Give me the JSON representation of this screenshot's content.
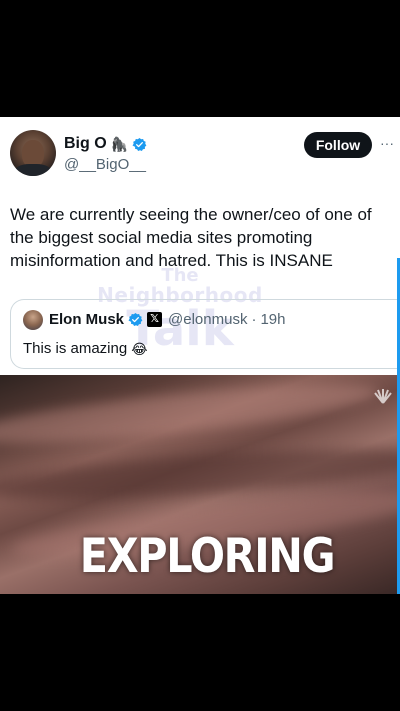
{
  "tweet": {
    "display_name": "Big O",
    "name_emoji": "🦍",
    "handle": "@__BigO__",
    "follow_label": "Follow",
    "more_label": "···",
    "text": "We are currently seeing the owner/ceo of one of the biggest social media sites promoting misinformation and hatred. This is INSANE"
  },
  "quoted_tweet": {
    "name": "Elon Musk",
    "affiliate_badge": "𝕏",
    "handle": "@elonmusk",
    "separator": "·",
    "time": "19h",
    "text": "This is amazing",
    "emoji": "😂"
  },
  "watermark": {
    "line1": "The",
    "line2": "Neighborhood",
    "line3": "Talk"
  },
  "video": {
    "caption": "EXPLORING"
  },
  "colors": {
    "verified": "#1d9bf0",
    "follow_button": "#0f1419",
    "text_primary": "#0f1419",
    "text_secondary": "#536471",
    "letterbox": "#000000"
  },
  "icons": {
    "verified": "verified-badge-icon",
    "more": "more-options-icon",
    "affiliate": "x-affiliate-icon"
  }
}
